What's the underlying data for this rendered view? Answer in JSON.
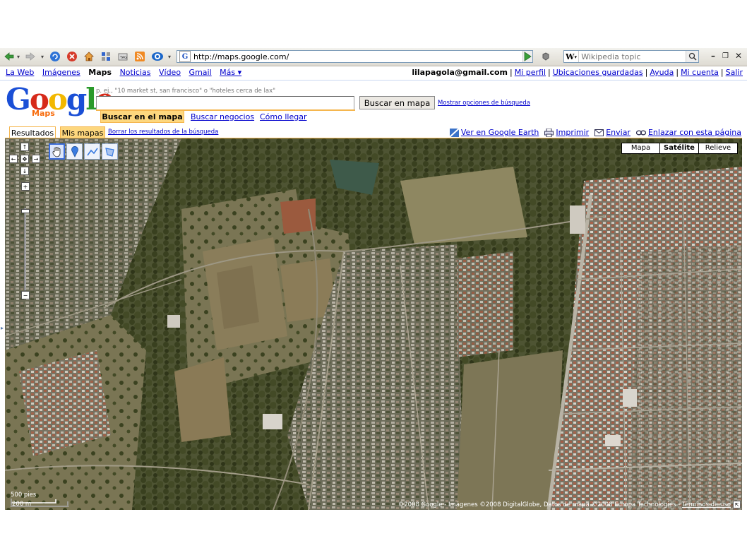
{
  "browser": {
    "url": "http://maps.google.com/",
    "search_placeholder": "Wikipedia topic",
    "search_engine_icon": "W"
  },
  "gbar": {
    "left": [
      "La Web",
      "Imágenes",
      "Maps",
      "Noticias",
      "Vídeo",
      "Gmail",
      "Más ▾"
    ],
    "user": "lilapagola@gmail.com",
    "right": [
      "Mi perfil",
      "Ubicaciones guardadas",
      "Ayuda",
      "Mi cuenta",
      "Salir"
    ]
  },
  "logo": {
    "text": "Google",
    "sub": "Maps"
  },
  "search": {
    "hint": "p. ej., \"10 market st, san francisco\" o \"hoteles cerca de lax\"",
    "query": "",
    "button": "Buscar en mapa",
    "options_link": "Mostrar opciones de búsqueda"
  },
  "search_tabs": {
    "active": "Buscar en el mapa",
    "businesses": "Buscar negocios",
    "directions": "Cómo llegar"
  },
  "results_tabs": {
    "results": "Resultados",
    "my_maps": "Mis mapas",
    "clear": "Borrar los resultados de la búsqueda"
  },
  "map_links": {
    "earth": "Ver en Google Earth",
    "print": "Imprimir",
    "send": "Enviar",
    "link": "Enlazar con esta página"
  },
  "map_types": {
    "map": "Mapa",
    "satellite": "Satélite",
    "terrain": "Relieve",
    "selected": "satellite"
  },
  "scale": {
    "feet": "500 pies",
    "meters": "200 m"
  },
  "copyright": {
    "text": "©2008 Google - Imágenes ©2008 DigitalGlobe, Datos de mapa ©2008 Europa Technologies - ",
    "terms": "Términos de uso"
  },
  "icons": [
    "back-icon",
    "forward-icon",
    "reload-icon",
    "stop-icon",
    "home-icon",
    "go-icon",
    "hand-tool-icon",
    "placemark-tool-icon",
    "line-tool-icon",
    "shape-tool-icon",
    "earth-icon",
    "print-icon",
    "mail-icon",
    "link-icon"
  ],
  "colors": {
    "link": "#0000cc",
    "accent_orange": "#f5b64e",
    "tab_active": "#fdd77e"
  }
}
